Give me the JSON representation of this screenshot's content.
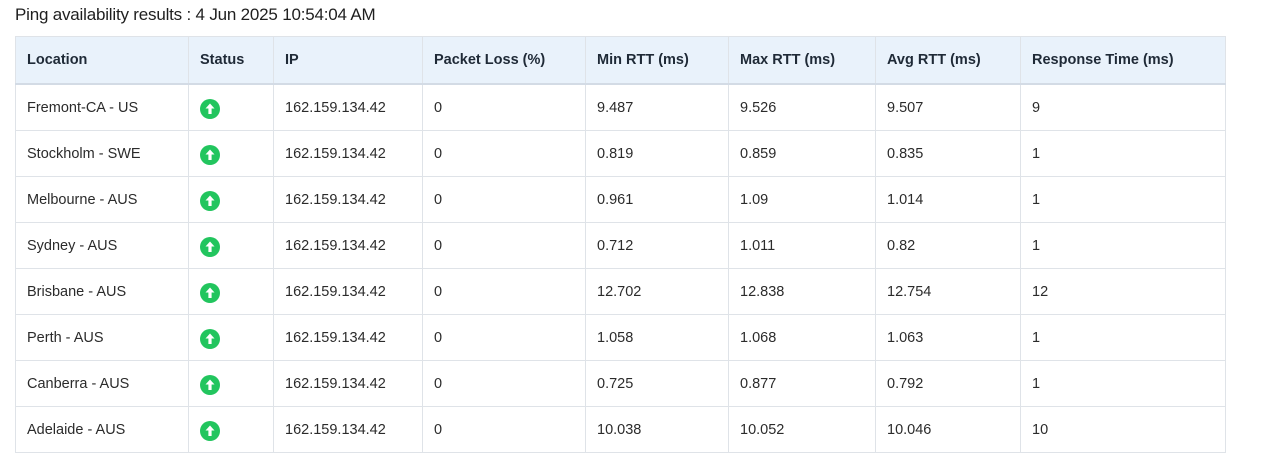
{
  "header": {
    "title_label": "Ping availability results :",
    "title_time": "4 Jun 2025 10:54:04 AM"
  },
  "colors": {
    "status_up": "#22c55e",
    "header_bg": "#e9f2fb",
    "border": "#dfe3e8"
  },
  "table": {
    "columns": [
      "Location",
      "Status",
      "IP",
      "Packet Loss (%)",
      "Min RTT (ms)",
      "Max RTT (ms)",
      "Avg RTT (ms)",
      "Response Time (ms)"
    ],
    "rows": [
      {
        "location": "Fremont-CA - US",
        "status": "up-arrow-icon",
        "ip": "162.159.134.42",
        "packet_loss": "0",
        "min_rtt": "9.487",
        "max_rtt": "9.526",
        "avg_rtt": "9.507",
        "response_time": "9"
      },
      {
        "location": "Stockholm - SWE",
        "status": "up-arrow-icon",
        "ip": "162.159.134.42",
        "packet_loss": "0",
        "min_rtt": "0.819",
        "max_rtt": "0.859",
        "avg_rtt": "0.835",
        "response_time": "1"
      },
      {
        "location": "Melbourne - AUS",
        "status": "up-arrow-icon",
        "ip": "162.159.134.42",
        "packet_loss": "0",
        "min_rtt": "0.961",
        "max_rtt": "1.09",
        "avg_rtt": "1.014",
        "response_time": "1"
      },
      {
        "location": "Sydney - AUS",
        "status": "up-arrow-icon",
        "ip": "162.159.134.42",
        "packet_loss": "0",
        "min_rtt": "0.712",
        "max_rtt": "1.011",
        "avg_rtt": "0.82",
        "response_time": "1"
      },
      {
        "location": "Brisbane - AUS",
        "status": "up-arrow-icon",
        "ip": "162.159.134.42",
        "packet_loss": "0",
        "min_rtt": "12.702",
        "max_rtt": "12.838",
        "avg_rtt": "12.754",
        "response_time": "12"
      },
      {
        "location": "Perth - AUS",
        "status": "up-arrow-icon",
        "ip": "162.159.134.42",
        "packet_loss": "0",
        "min_rtt": "1.058",
        "max_rtt": "1.068",
        "avg_rtt": "1.063",
        "response_time": "1"
      },
      {
        "location": "Canberra - AUS",
        "status": "up-arrow-icon",
        "ip": "162.159.134.42",
        "packet_loss": "0",
        "min_rtt": "0.725",
        "max_rtt": "0.877",
        "avg_rtt": "0.792",
        "response_time": "1"
      },
      {
        "location": "Adelaide - AUS",
        "status": "up-arrow-icon",
        "ip": "162.159.134.42",
        "packet_loss": "0",
        "min_rtt": "10.038",
        "max_rtt": "10.052",
        "avg_rtt": "10.046",
        "response_time": "10"
      }
    ]
  }
}
